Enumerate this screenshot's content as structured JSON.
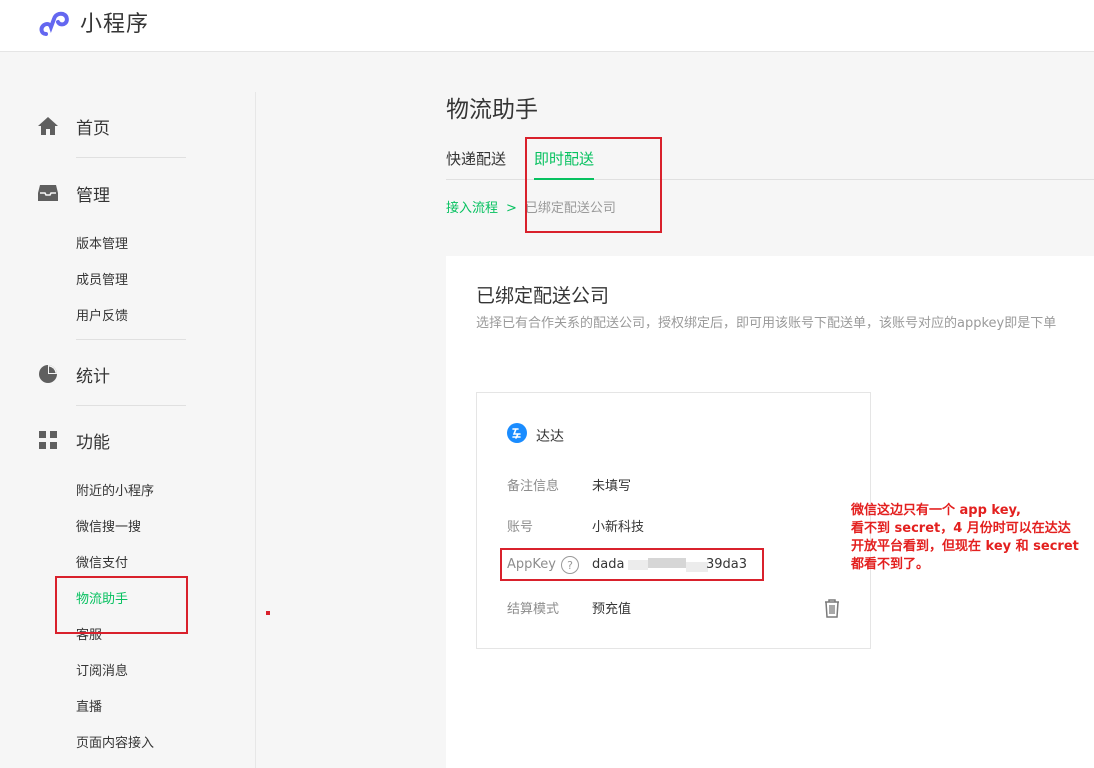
{
  "header": {
    "app_name": "小程序",
    "logo_icon": "miniprogram-logo-icon"
  },
  "sidebar": {
    "home": {
      "label": "首页",
      "icon": "home-icon"
    },
    "manage": {
      "label": "管理",
      "icon": "inbox-icon",
      "items": [
        "版本管理",
        "成员管理",
        "用户反馈"
      ]
    },
    "stats": {
      "label": "统计",
      "icon": "pie-chart-icon"
    },
    "features": {
      "label": "功能",
      "icon": "grid-icon",
      "items": [
        "附近的小程序",
        "微信搜一搜",
        "微信支付",
        "物流助手",
        "客服",
        "订阅消息",
        "直播",
        "页面内容接入"
      ],
      "active_item": "物流助手"
    }
  },
  "main": {
    "title": "物流助手",
    "tabs": [
      {
        "label": "快递配送"
      },
      {
        "label": "即时配送",
        "active": true
      }
    ],
    "breadcrumb": {
      "link": "接入流程",
      "separator": ">",
      "current": "已绑定配送公司"
    },
    "card": {
      "title": "已绑定配送公司",
      "description": "选择已有合作关系的配送公司，授权绑定后，即可用该账号下配送单，该账号对应的appkey即是下单",
      "company": {
        "name": "达达",
        "rows": [
          {
            "label": "备注信息",
            "value": "未填写"
          },
          {
            "label": "账号",
            "value": "小新科技"
          },
          {
            "label": "AppKey",
            "value_prefix": "dada",
            "value_suffix": "39da3"
          },
          {
            "label": "结算模式",
            "value": "预充值"
          }
        ]
      }
    }
  },
  "annotation": {
    "lines": [
      "微信这边只有一个 app key,",
      "看不到 secret，4 月份时可以在达达",
      "开放平台看到，但现在 key 和 secret",
      "都看不到了。"
    ],
    "color": "#e3201f"
  },
  "accent_color": "#07c160"
}
